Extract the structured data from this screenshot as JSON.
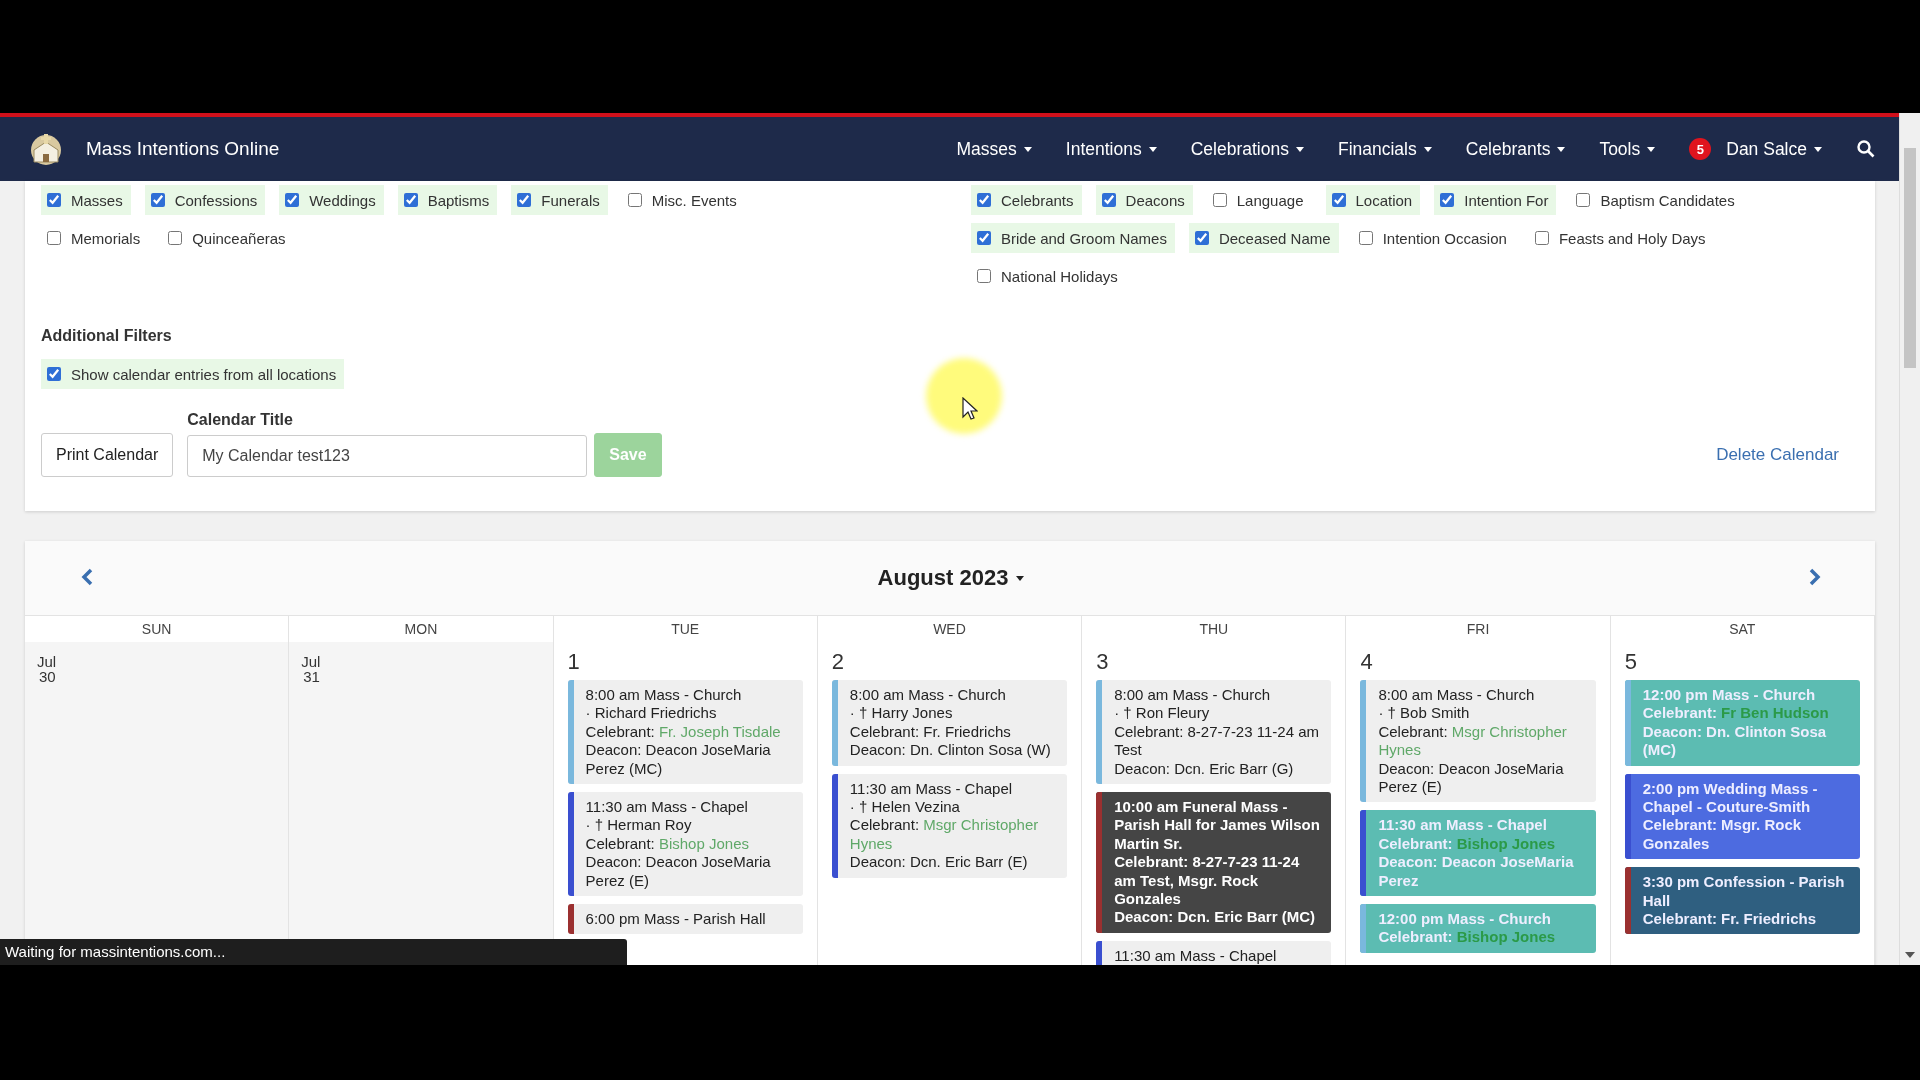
{
  "navbar": {
    "brand": "Mass Intentions Online",
    "menus": [
      {
        "label": "Masses"
      },
      {
        "label": "Intentions"
      },
      {
        "label": "Celebrations"
      },
      {
        "label": "Financials"
      },
      {
        "label": "Celebrants"
      },
      {
        "label": "Tools"
      }
    ],
    "user": {
      "badge": "5",
      "name": "Dan Salce"
    }
  },
  "filters": {
    "event_types": [
      {
        "label": "Masses",
        "checked": true
      },
      {
        "label": "Confessions",
        "checked": true
      },
      {
        "label": "Weddings",
        "checked": true
      },
      {
        "label": "Baptisms",
        "checked": true
      },
      {
        "label": "Funerals",
        "checked": true
      },
      {
        "label": "Misc. Events",
        "checked": false
      },
      {
        "label": "Memorials",
        "checked": false
      },
      {
        "label": "Quinceañeras",
        "checked": false
      }
    ],
    "display_fields": [
      {
        "label": "Celebrants",
        "checked": true
      },
      {
        "label": "Deacons",
        "checked": true
      },
      {
        "label": "Language",
        "checked": false
      },
      {
        "label": "Location",
        "checked": true
      },
      {
        "label": "Intention For",
        "checked": true
      },
      {
        "label": "Baptism Candidates",
        "checked": false
      },
      {
        "label": "Bride and Groom Names",
        "checked": true
      },
      {
        "label": "Deceased Name",
        "checked": true
      },
      {
        "label": "Intention Occasion",
        "checked": false
      },
      {
        "label": "Feasts and Holy Days",
        "checked": false
      },
      {
        "label": "National Holidays",
        "checked": false
      }
    ],
    "additional_title": "Additional Filters",
    "additional": [
      {
        "label": "Show calendar entries from all locations",
        "checked": true
      }
    ],
    "print_button": "Print Calendar",
    "title_label": "Calendar Title",
    "title_value": "My Calendar test123",
    "save_button": "Save",
    "save_disabled": true,
    "delete_link": "Delete Calendar"
  },
  "calendar": {
    "title": "August 2023",
    "weekdays": [
      "SUN",
      "MON",
      "TUE",
      "WED",
      "THU",
      "FRI",
      "SAT"
    ],
    "days": [
      {
        "month": "Jul",
        "day": "30"
      },
      {
        "month": "Jul",
        "day": "31"
      },
      {
        "day": "1",
        "events": [
          {
            "kind": "plain",
            "color": "#7ab8dd",
            "lines": [
              {
                "text": "8:00 am Mass - Church"
              },
              {
                "text": "· Richard Friedrichs"
              },
              {
                "label": "Celebrant:",
                "text": "Fr. Joseph Tisdale",
                "highlight": true
              },
              {
                "label": "Deacon:",
                "text": "Deacon JoseMaria Perez (MC)"
              }
            ]
          },
          {
            "kind": "plain",
            "color": "#3a4fd0",
            "lines": [
              {
                "text": "11:30 am Mass - Chapel"
              },
              {
                "text": "· † Herman Roy"
              },
              {
                "label": "Celebrant:",
                "text": "Bishop Jones",
                "highlight": true
              },
              {
                "label": "Deacon:",
                "text": "Deacon JoseMaria Perez (E)"
              }
            ]
          },
          {
            "kind": "plain",
            "color": "#9b3030",
            "lines": [
              {
                "text": "6:00 pm Mass - Parish Hall"
              }
            ]
          }
        ]
      },
      {
        "day": "2",
        "events": [
          {
            "kind": "plain",
            "color": "#7ab8dd",
            "lines": [
              {
                "text": "8:00 am Mass - Church"
              },
              {
                "text": "· † Harry Jones"
              },
              {
                "label": "Celebrant:",
                "text": "Fr. Friedrichs",
                "highlight": false
              },
              {
                "label": "Deacon:",
                "text": "Dn. Clinton Sosa (W)"
              }
            ]
          },
          {
            "kind": "plain",
            "color": "#3a4fd0",
            "lines": [
              {
                "text": "11:30 am Mass - Chapel"
              },
              {
                "text": "· † Helen Vezina"
              },
              {
                "label": "Celebrant:",
                "text": "Msgr Christopher Hynes",
                "highlight": true
              },
              {
                "label": "Deacon:",
                "text": "Dcn. Eric Barr (E)"
              }
            ]
          }
        ]
      },
      {
        "day": "3",
        "events": [
          {
            "kind": "plain",
            "color": "#7ab8dd",
            "lines": [
              {
                "text": "8:00 am Mass - Church"
              },
              {
                "text": "· † Ron Fleury"
              },
              {
                "label": "Celebrant:",
                "text": "8-27-7-23 11-24 am Test",
                "highlight": false
              },
              {
                "label": "Deacon:",
                "text": "Dcn. Eric Barr (G)"
              }
            ]
          },
          {
            "kind": "dark",
            "color": "#9b3030",
            "lines": [
              {
                "text": "10:00 am Funeral Mass - Parish Hall for James Wilson Martin Sr."
              },
              {
                "label": "Celebrant:",
                "text": "8-27-7-23 11-24 am Test, Msgr. Rock Gonzales",
                "highlight": false
              },
              {
                "label": "Deacon:",
                "text": "Dcn. Eric Barr (MC)"
              }
            ]
          },
          {
            "kind": "plain",
            "color": "#3a4fd0",
            "lines": [
              {
                "text": "11:30 am Mass - Chapel"
              }
            ]
          }
        ]
      },
      {
        "day": "4",
        "events": [
          {
            "kind": "plain",
            "color": "#7ab8dd",
            "lines": [
              {
                "text": "8:00 am Mass - Church"
              },
              {
                "text": "· † Bob Smith"
              },
              {
                "label": "Celebrant:",
                "text": "Msgr Christopher Hynes",
                "highlight": true
              },
              {
                "label": "Deacon:",
                "text": "Deacon JoseMaria Perez (E)"
              }
            ]
          },
          {
            "kind": "teal",
            "color": "#3a4fd0",
            "lines": [
              {
                "text": "11:30 am Mass - Chapel"
              },
              {
                "label": "Celebrant:",
                "text": "Bishop Jones",
                "highlight": true
              },
              {
                "label": "Deacon:",
                "text": "Deacon JoseMaria Perez"
              }
            ]
          },
          {
            "kind": "teal",
            "color": "#7ab8dd",
            "lines": [
              {
                "text": "12:00 pm Mass - Church"
              },
              {
                "label": "Celebrant:",
                "text": "Bishop Jones",
                "highlight": true
              }
            ]
          }
        ]
      },
      {
        "day": "5",
        "events": [
          {
            "kind": "teal",
            "color": "#7ab8dd",
            "lines": [
              {
                "text": "12:00 pm Mass - Church"
              },
              {
                "label": "Celebrant:",
                "text": "Fr Ben Hudson",
                "highlight": true
              },
              {
                "label": "Deacon:",
                "text": "Dn. Clinton Sosa (MC)"
              }
            ]
          },
          {
            "kind": "blue",
            "color": "#3a4fd0",
            "lines": [
              {
                "text": "2:00 pm Wedding Mass - Chapel - Couture-Smith"
              },
              {
                "label": "Celebrant:",
                "text": "Msgr. Rock Gonzales",
                "highlight": false
              }
            ]
          },
          {
            "kind": "slate",
            "color": "#9b3030",
            "lines": [
              {
                "text": "3:30 pm Confession - Parish Hall"
              },
              {
                "label": "Celebrant:",
                "text": "Fr. Friedrichs",
                "highlight": false
              }
            ]
          }
        ]
      }
    ]
  },
  "status_bar": "Waiting for massintentions.com..."
}
